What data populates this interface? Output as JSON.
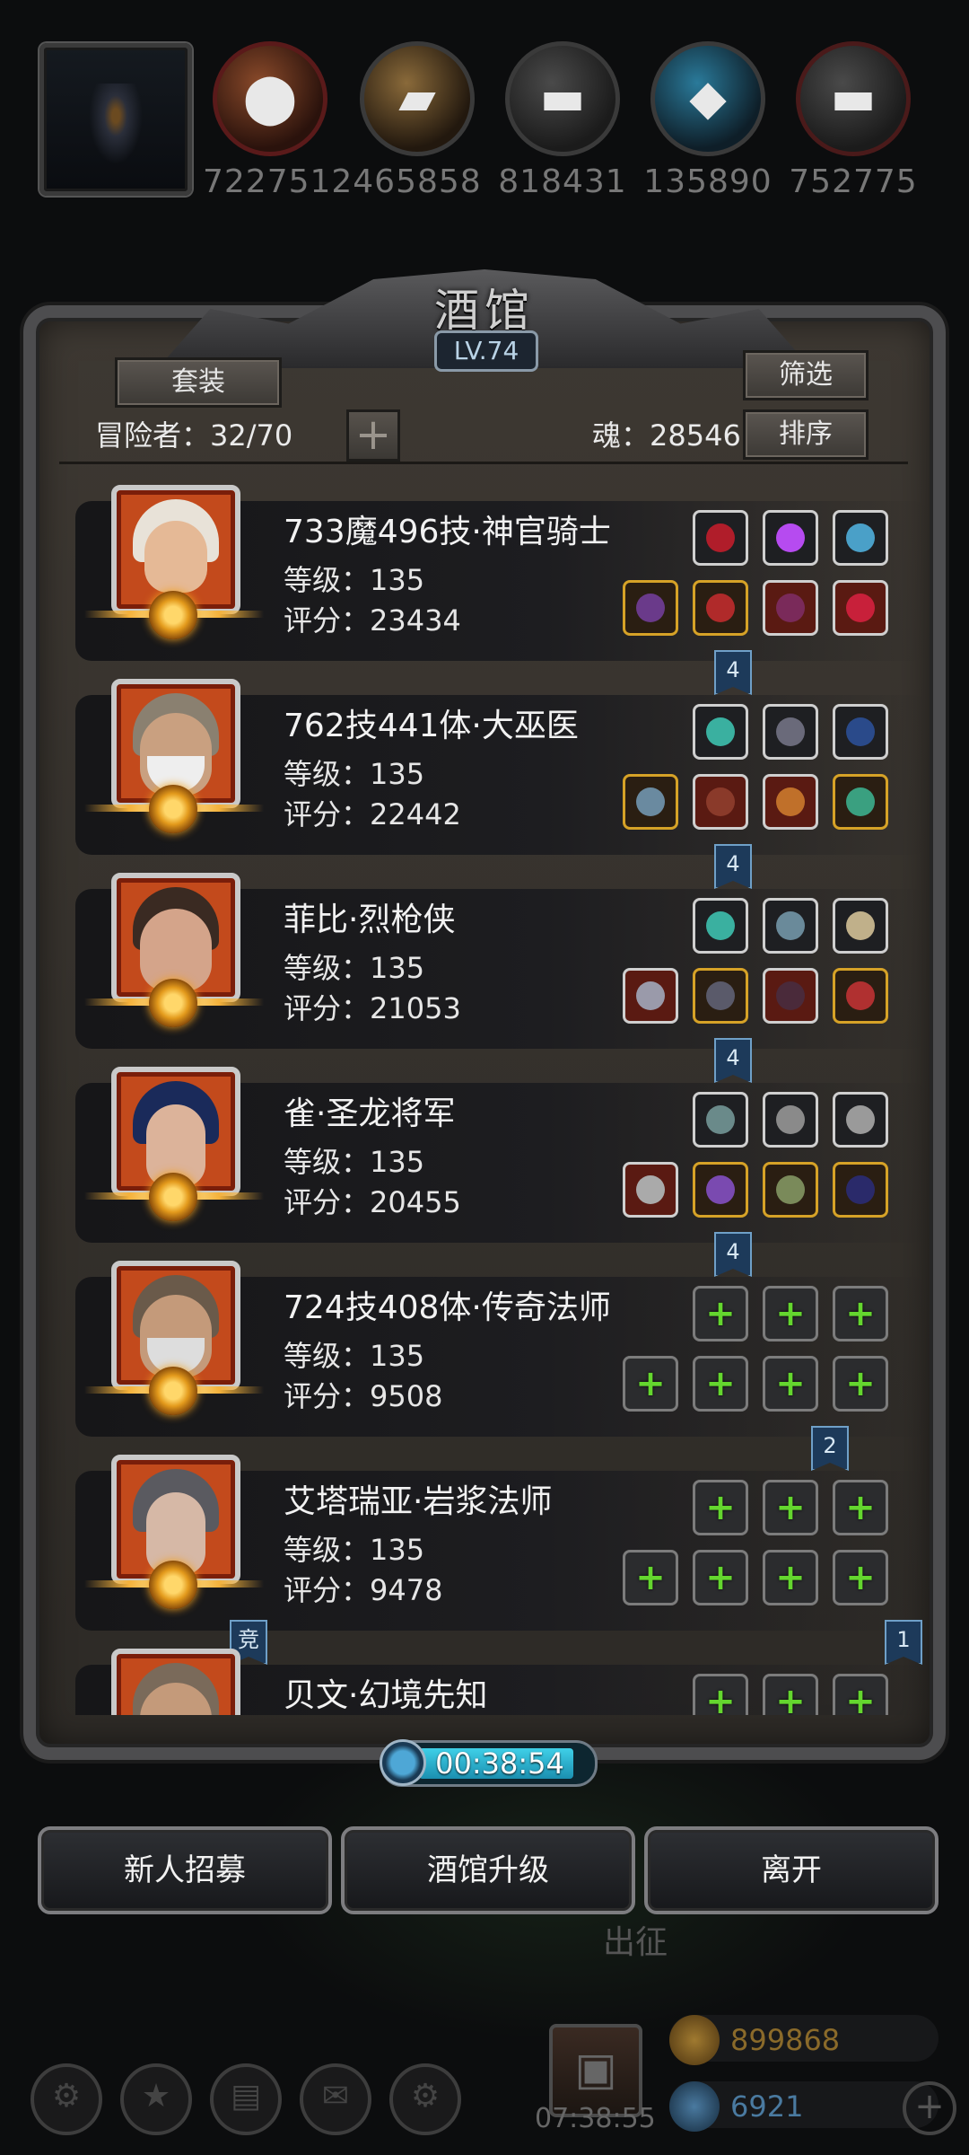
{
  "colors": {
    "panel": "#2d2a26",
    "accent_blue": "#3fd0e8",
    "gold": "#d6a227",
    "green_plus": "#64d62e",
    "portrait_red": "#c34a1c"
  },
  "resources": [
    {
      "icon": "ore-icon",
      "value": "7227512"
    },
    {
      "icon": "wood-icon",
      "value": "465858"
    },
    {
      "icon": "iron-icon",
      "value": "818431"
    },
    {
      "icon": "crystal-icon",
      "value": "135890"
    },
    {
      "icon": "steel-icon",
      "value": "752775"
    }
  ],
  "panel": {
    "title": "酒馆",
    "level": "LV.74",
    "set_label": "套装",
    "filter_label": "筛选",
    "sort_label": "排序",
    "adventurer_count": "冒险者：32/70",
    "soul": "魂：28546"
  },
  "adventurers": [
    {
      "name": "733魔496技·神官骑士",
      "level": "等级：135",
      "score": "评分：23434",
      "tag": "4"
    },
    {
      "name": "762技441体·大巫医",
      "level": "等级：135",
      "score": "评分：22442",
      "tag": "4"
    },
    {
      "name": "菲比·烈枪侠",
      "level": "等级：135",
      "score": "评分：21053",
      "tag": "4"
    },
    {
      "name": "雀·圣龙将军",
      "level": "等级：135",
      "score": "评分：20455",
      "tag": "4"
    },
    {
      "name": "724技408体·传奇法师",
      "level": "等级：135",
      "score": "评分：9508",
      "tag": "2"
    },
    {
      "name": "艾塔瑞亚·岩浆法师",
      "level": "等级：135",
      "score": "评分：9478",
      "tag": "1",
      "tag_left": "竞"
    },
    {
      "name": "贝文·幻境先知",
      "level": "",
      "score": ""
    }
  ],
  "timer": "00:38:54",
  "buttons": {
    "recruit": "新人招募",
    "upgrade": "酒馆升级",
    "leave": "离开"
  },
  "background": {
    "depart": "出征",
    "countdown": "07:38:55",
    "gold": "899868",
    "gems": "6921"
  }
}
